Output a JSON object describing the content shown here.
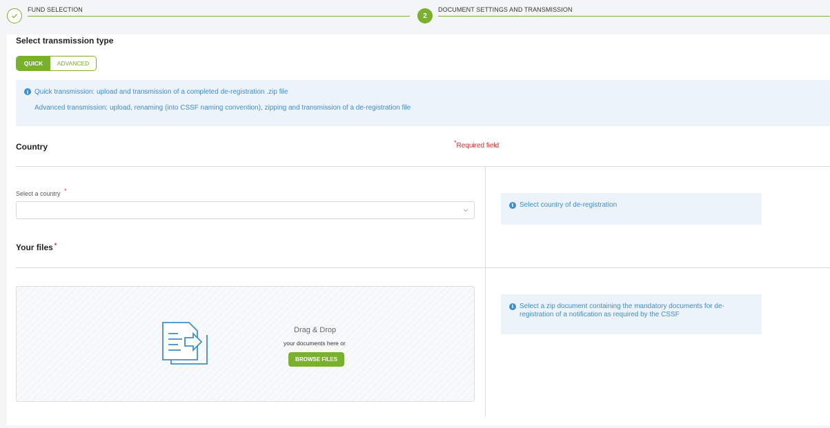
{
  "stepper": {
    "step1": {
      "label": "FUND SELECTION"
    },
    "step2": {
      "number": "2",
      "label": "DOCUMENT SETTINGS AND TRANSMISSION"
    }
  },
  "transmission": {
    "title": "Select transmission type",
    "options": [
      "QUICK",
      "ADVANCED"
    ],
    "selected": "QUICK",
    "info": {
      "quick": "Quick transmission: upload and transmission of a completed de-registration .zip file",
      "advanced": "Advanced transmission: upload, renaming (into CSSF naming convention), zipping and transmission of a de-registration file"
    }
  },
  "country": {
    "title": "Country",
    "required_note": "Required field",
    "required_star": "*",
    "field_label": "Select a country",
    "field_value": "",
    "help": "Select country of de-registration"
  },
  "files": {
    "title": "Your files",
    "dropzone": {
      "title": "Drag & Drop",
      "subtitle": "your documents here or",
      "button": "BROWSE FILES"
    },
    "help": "Select a zip document containing the mandatory documents for de-registration of a notification as required by the CSSF"
  },
  "colors": {
    "accent_green": "#79b02d",
    "info_blue": "#3f8ec9",
    "info_bg": "#ecf3fa",
    "required_red": "#d32f2f"
  },
  "icons": {
    "step1": "checkmark-icon",
    "info": "info-icon",
    "select": "chevron-down-icon",
    "upload": "document-upload-icon"
  }
}
